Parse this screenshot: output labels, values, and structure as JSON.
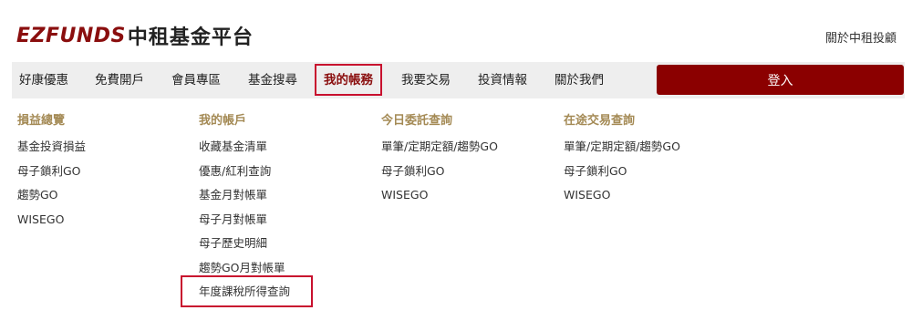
{
  "header": {
    "logo_mark": "EZFUNDS",
    "logo_text": "中租基金平台",
    "about_link": "關於中租投顧"
  },
  "nav": {
    "items": [
      {
        "label": "好康優惠"
      },
      {
        "label": "免費開戶"
      },
      {
        "label": "會員專區"
      },
      {
        "label": "基金搜尋"
      },
      {
        "label": "我的帳務"
      },
      {
        "label": "我要交易"
      },
      {
        "label": "投資情報"
      },
      {
        "label": "關於我們"
      }
    ],
    "active_index": 4,
    "login_label": "登入"
  },
  "menu": {
    "columns": [
      {
        "title": "損益總覽",
        "items": [
          "基金投資損益",
          "母子鎖利GO",
          "趨勢GO",
          "WISEGO"
        ]
      },
      {
        "title": "我的帳戶",
        "items": [
          "收藏基金清單",
          "優惠/紅利查詢",
          "基金月對帳單",
          "母子月對帳單",
          "母子歷史明細",
          "趨勢GO月對帳單",
          "年度課稅所得查詢"
        ]
      },
      {
        "title": "今日委託查詢",
        "items": [
          "單筆/定期定額/趨勢GO",
          "母子鎖利GO",
          "WISEGO"
        ]
      },
      {
        "title": "在途交易查詢",
        "items": [
          "單筆/定期定額/趨勢GO",
          "母子鎖利GO",
          "WISEGO"
        ]
      }
    ]
  },
  "colors": {
    "brand": "#8b0000",
    "menu_title": "#a48a55",
    "highlight": "#c8102e",
    "nav_bg": "#eeeeee"
  }
}
